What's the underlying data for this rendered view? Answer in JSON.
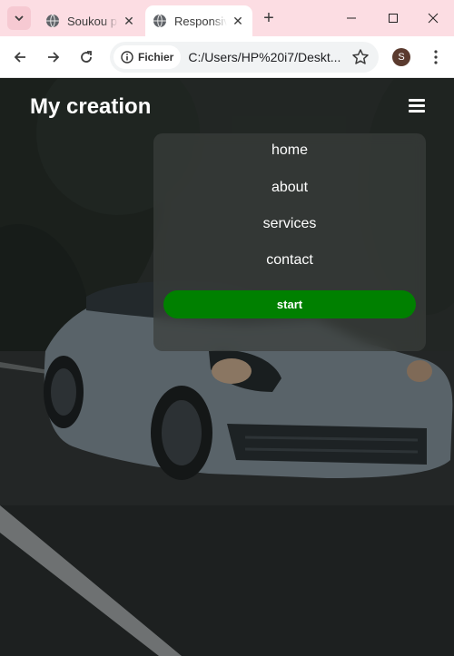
{
  "browser": {
    "tabs": [
      {
        "title": "Soukou p",
        "active": false
      },
      {
        "title": "Responsiv",
        "active": true
      }
    ],
    "address": {
      "chip_label": "Fichier",
      "url": "C:/Users/HP%20i7/Deskt..."
    },
    "profile_initial": "S",
    "accent_color": "#fcdde3"
  },
  "page": {
    "logo": "My creation",
    "menu": {
      "items": [
        "home",
        "about",
        "services",
        "contact"
      ],
      "cta_label": "start",
      "cta_color": "#008000"
    }
  }
}
